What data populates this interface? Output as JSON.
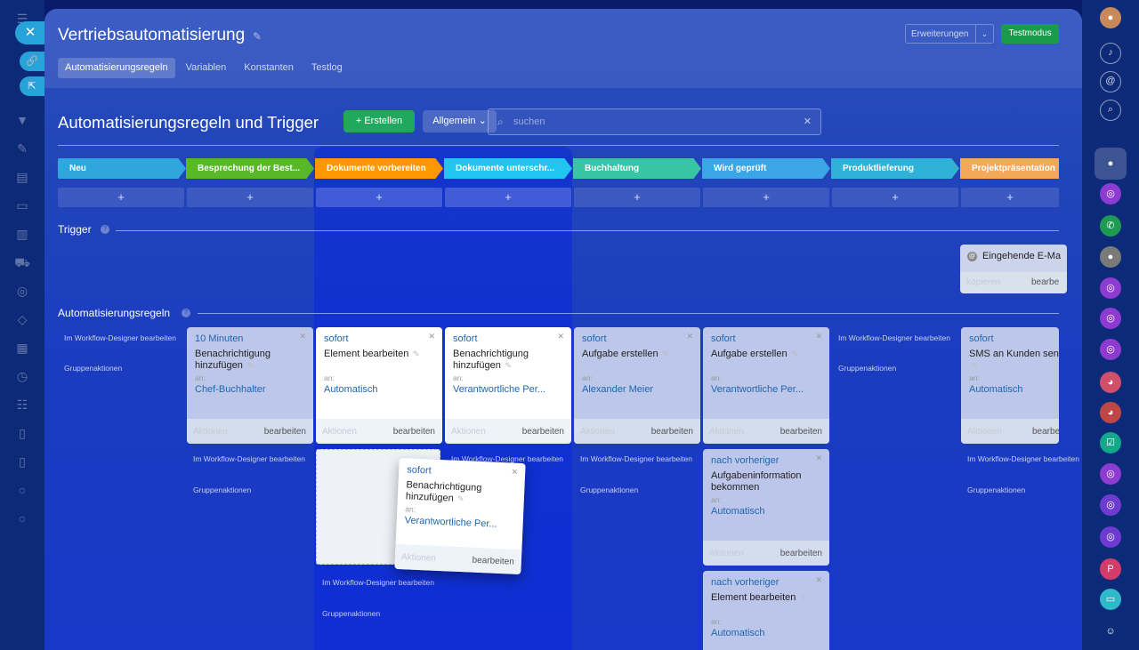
{
  "header": {
    "title": "Vertriebsautomatisierung",
    "extensions_label": "Erweiterungen",
    "test_mode_label": "Testmodus"
  },
  "tabs": [
    {
      "label": "Automatisierungsregeln"
    },
    {
      "label": "Variablen"
    },
    {
      "label": "Konstanten"
    },
    {
      "label": "Testlog"
    }
  ],
  "toolbar": {
    "section_title": "Automatisierungsregeln und Trigger",
    "create_label": "Erstellen",
    "general_label": "Allgemein",
    "search_placeholder": "suchen"
  },
  "stages": [
    {
      "label": "Neu",
      "color": "#2fa7dc"
    },
    {
      "label": "Besprechung der Best...",
      "color": "#58b82a"
    },
    {
      "label": "Dokumente vorbereiten",
      "color": "#ff9800"
    },
    {
      "label": "Dokumente unterschr...",
      "color": "#20c6f0"
    },
    {
      "label": "Buchhaltung",
      "color": "#36c6a3"
    },
    {
      "label": "Wird geprüft",
      "color": "#3aa6e6"
    },
    {
      "label": "Produktlieferung",
      "color": "#2fb1d8"
    },
    {
      "label": "Projektpräsentation",
      "color": "#f3a85a"
    }
  ],
  "add_symbol": "+",
  "trigger_section": {
    "label": "Trigger",
    "card": {
      "name": "Eingehende E-Ma",
      "copy_label": "kopieren",
      "edit_label": "bearbe"
    }
  },
  "rules_section": {
    "label": "Automatisierungsregeln"
  },
  "links": {
    "workflow_designer": "Im Workflow-Designer bearbeiten",
    "group_actions": "Gruppenaktionen"
  },
  "card_common": {
    "recipient_label": "an:",
    "actions_label": "Aktionen",
    "edit_label": "bearbeiten"
  },
  "cards": [
    {
      "delay": "10 Minuten",
      "name": "Benachrichtigung hinzufügen",
      "to": "Chef-Buchhalter"
    },
    {
      "delay": "sofort",
      "name": "Element bearbeiten",
      "to": "Automatisch"
    },
    {
      "delay": "sofort",
      "name": "Benachrichtigung hinzufügen",
      "to": "Verantwortliche Per..."
    },
    {
      "delay": "sofort",
      "name": "Aufgabe erstellen",
      "to": "Alexander Meier"
    },
    {
      "delay": "sofort",
      "name": "Aufgabe erstellen",
      "to": "Verantwortliche Per..."
    },
    {
      "delay": "sofort",
      "name": "SMS an Kunden send",
      "to": "Automatisch",
      "edit_label": "bearbe"
    },
    {
      "delay": "nach vorheriger",
      "name": "Aufgabeninformation bekommen",
      "to": "Automatisch"
    },
    {
      "delay": "nach vorheriger",
      "name": "Element bearbeiten",
      "to": "Automatisch"
    }
  ],
  "drag_card": {
    "delay": "sofort",
    "name": "Benachrichtigung hinzufügen",
    "to": "Verantwortliche Per..."
  }
}
